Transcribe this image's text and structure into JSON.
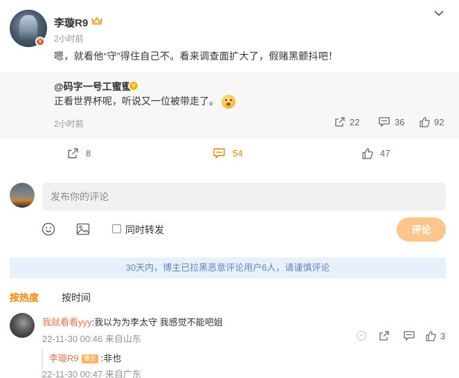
{
  "post": {
    "username": "李璇R9",
    "time": "2小时前",
    "text": "嗯，就看他“守”得住自己不。看来调查面扩大了，假赌黑颤抖吧！",
    "crown_icon": "crown-icon"
  },
  "repost": {
    "user": "@码字一号工蜜蜜",
    "text": "正看世界杯呢，听说又一位被带走了。",
    "time": "2小时前",
    "shares": "22",
    "comments": "36",
    "likes": "92"
  },
  "actions": {
    "shares": "8",
    "comments": "54",
    "likes": "47",
    "active_color": "#ff8200"
  },
  "composer": {
    "placeholder": "发布你的评论",
    "repost_label": "同时转发",
    "submit_label": "评论"
  },
  "notice": "30天内，博主已拉黑恶意评论用户6人，请谨慎评论",
  "sort": {
    "hot": "按热度",
    "time": "按时间"
  },
  "comments": [
    {
      "user": "我就看看yyy",
      "text": ":我以为为李太守   我感觉不能吧姐",
      "meta": "22-11-30 00:46 来自山东",
      "likes": "3",
      "replies": [
        {
          "user": "李璇R9",
          "badge": "博主",
          "text": ":非也",
          "meta": "22-11-30 00:47 来自广东"
        }
      ]
    }
  ]
}
